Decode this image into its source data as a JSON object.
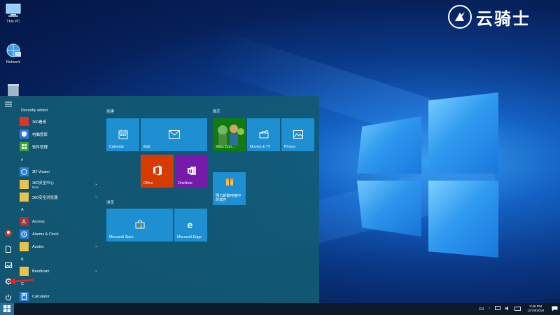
{
  "desktop": {
    "icons": [
      {
        "label": "This PC",
        "icon": "this-pc-icon"
      },
      {
        "label": "Network",
        "icon": "network-icon"
      },
      {
        "label": "",
        "icon": "recycle-bin-icon"
      }
    ]
  },
  "watermark": {
    "text": "云骑士"
  },
  "start_menu": {
    "recently_added_label": "Recently added",
    "apps": {
      "recent": [
        {
          "name": "360看纸",
          "icon": "app-icon",
          "color": "#d9362b"
        },
        {
          "name": "电脑管家",
          "icon": "shield-icon",
          "color": "#2e7be0"
        },
        {
          "name": "软件管理",
          "icon": "grid-icon",
          "color": "#3aa63a"
        }
      ],
      "hash_label": "#",
      "hash": [
        {
          "name": "3D Viewer",
          "icon": "cube-icon",
          "color": "#2a7fd4",
          "sub": ""
        },
        {
          "name": "360安全中心",
          "icon": "folder-icon",
          "color": "#e8c24a",
          "sub": "New"
        },
        {
          "name": "360安全浏览器",
          "icon": "folder-icon",
          "color": "#e8c24a",
          "sub": ""
        }
      ],
      "a_label": "A",
      "a": [
        {
          "name": "Access",
          "icon": "access-icon",
          "color": "#a4373a"
        },
        {
          "name": "Alarms & Clock",
          "icon": "clock-icon",
          "color": "#2a7fd4"
        },
        {
          "name": "Austec",
          "icon": "folder-icon",
          "color": "#e8c24a"
        }
      ],
      "b_label": "B",
      "b": [
        {
          "name": "Bandicam",
          "icon": "folder-icon",
          "color": "#e8c24a"
        }
      ],
      "c_label": "C",
      "c": [
        {
          "name": "Calculator",
          "icon": "calculator-icon",
          "color": "#2a7fd4"
        }
      ]
    },
    "groups": {
      "create": "创建",
      "play": "娱乐",
      "browse": "浏览"
    },
    "tiles": {
      "calendar": "Calendar",
      "mail": "Mail",
      "office": "Office",
      "onenote": "OneNote",
      "xbox": "Xbox Con...",
      "movies": "Movies & TV",
      "photos": "Photos",
      "game_tile": "强力卸载电脑中的软件",
      "store": "Microsoft Store",
      "edge": "Microsoft Edge"
    }
  },
  "taskbar": {
    "tray_lang": "EN",
    "time": "3:46 PM",
    "date": "11/19/2019"
  },
  "colors": {
    "accent": "#1e8fd0",
    "office": "#d83b01",
    "onenote": "#7719aa",
    "xbox": "#107c10",
    "annotation_arrow": "#e8241c"
  }
}
